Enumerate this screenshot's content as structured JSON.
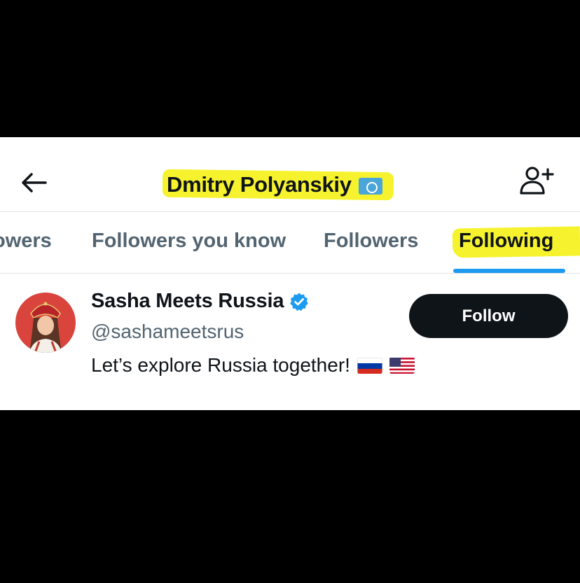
{
  "header": {
    "title": "Dmitry Polyanskiy",
    "title_flag_icon": "un-flag-icon",
    "highlight_color": "#f6f32e"
  },
  "tabs": [
    {
      "label": "owers",
      "active": false
    },
    {
      "label": "Followers you know",
      "active": false
    },
    {
      "label": "Followers",
      "active": false
    },
    {
      "label": "Following",
      "active": true
    }
  ],
  "tab_indicator_color": "#1d9bf0",
  "user": {
    "name": "Sasha Meets Russia",
    "handle": "@sashameetsrus",
    "bio": "Let’s explore Russia together!",
    "bio_flags": [
      "russia-flag-icon",
      "usa-flag-icon"
    ],
    "verified": true,
    "verified_color": "#1d9bf0",
    "follow_label": "Follow"
  }
}
